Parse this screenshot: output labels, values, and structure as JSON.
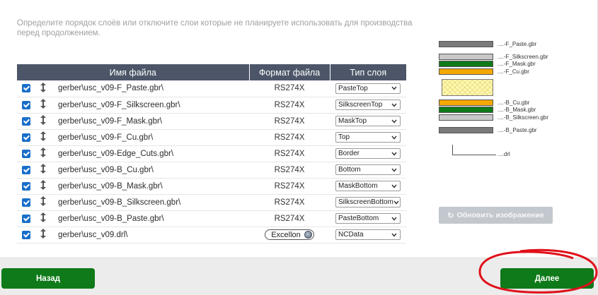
{
  "instruction": "Определите порядок слоёв или отключите слои которые не планируете использовать для производства перед продолжением.",
  "table": {
    "headers": {
      "file_name": "Имя файла",
      "file_format": "Формат файла",
      "layer_type": "Тип слоя"
    },
    "rows": [
      {
        "checked": true,
        "file": "gerber\\usc_v09-F_Paste.gbr\\",
        "format": "RS274X",
        "type": "PasteTop"
      },
      {
        "checked": true,
        "file": "gerber\\usc_v09-F_Silkscreen.gbr\\",
        "format": "RS274X",
        "type": "SilkscreenTop"
      },
      {
        "checked": true,
        "file": "gerber\\usc_v09-F_Mask.gbr\\",
        "format": "RS274X",
        "type": "MaskTop"
      },
      {
        "checked": true,
        "file": "gerber\\usc_v09-F_Cu.gbr\\",
        "format": "RS274X",
        "type": "Top"
      },
      {
        "checked": true,
        "file": "gerber\\usc_v09-Edge_Cuts.gbr\\",
        "format": "RS274X",
        "type": "Border"
      },
      {
        "checked": true,
        "file": "gerber\\usc_v09-B_Cu.gbr\\",
        "format": "RS274X",
        "type": "Bottom"
      },
      {
        "checked": true,
        "file": "gerber\\usc_v09-B_Mask.gbr\\",
        "format": "RS274X",
        "type": "MaskBottom"
      },
      {
        "checked": true,
        "file": "gerber\\usc_v09-B_Silkscreen.gbr\\",
        "format": "RS274X",
        "type": "SilkscreenBottom"
      },
      {
        "checked": true,
        "file": "gerber\\usc_v09-B_Paste.gbr\\",
        "format": "RS274X",
        "type": "PasteBottom"
      },
      {
        "checked": true,
        "file": "gerber\\usc_v09.drl\\",
        "format": "Excellon",
        "type": "NCData"
      }
    ]
  },
  "stackup": {
    "labels": {
      "f_paste": "....-F_Paste.gbr",
      "f_silk": "....-F_Silkscreen.gbr",
      "f_mask": "....-F_Mask.gbr",
      "f_cu": "....-F_Cu.gbr",
      "b_cu": "....-B_Cu.gbr",
      "b_mask": "....-B_Mask.gbr",
      "b_silk": "....-B_Silkscreen.gbr",
      "b_paste": "....-B_Paste.gbr",
      "drl": "....drl"
    },
    "colors": {
      "paste": "#7a7a7a",
      "silk": "#c8c8c8",
      "mask": "#0f7a19",
      "copper": "#f5a800",
      "board": "#fff8b0"
    }
  },
  "refresh_button": "Обновить изображение",
  "back_button": "Назад",
  "next_button": "Далее",
  "colors": {
    "header_bg": "#4c5668",
    "primary_button": "#0f7a19",
    "checkbox": "#1a6ec9",
    "annotation": "#e0101a"
  }
}
